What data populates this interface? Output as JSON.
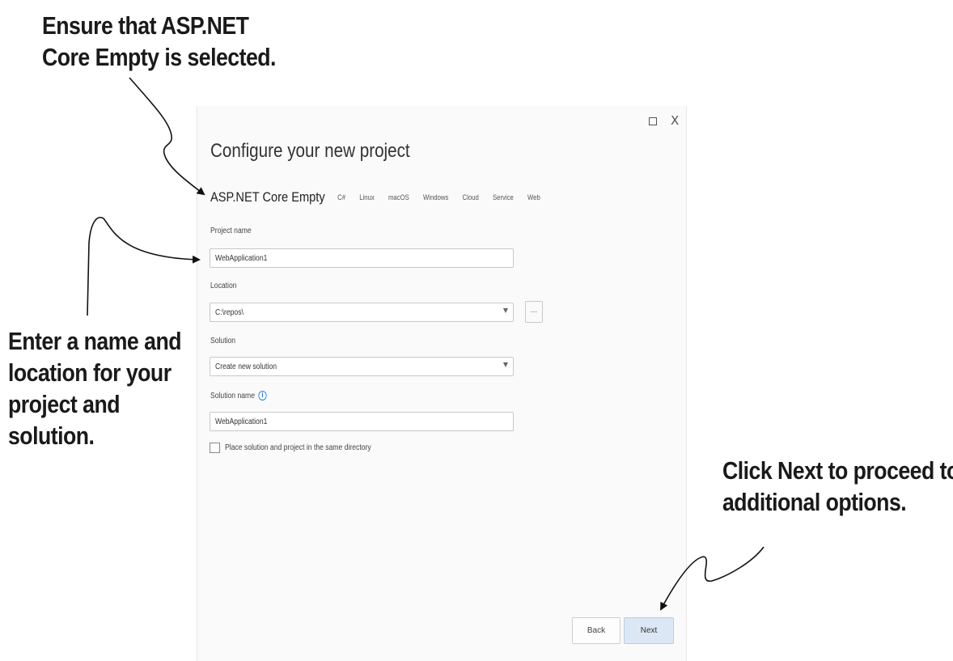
{
  "callouts": {
    "top": [
      "Ensure that ASP.NET",
      "Core Empty is selected."
    ],
    "left": [
      "Enter a name and",
      "location for your",
      "project and",
      "solution."
    ],
    "right": [
      "Click Next to proceed to",
      "additional options."
    ]
  },
  "window": {
    "title": "Configure your new project",
    "template_name": "ASP.NET Core Empty",
    "tags": [
      "C#",
      "Linux",
      "macOS",
      "Windows",
      "Cloud",
      "Service",
      "Web"
    ],
    "maximize_icon": "□",
    "close_icon": "X"
  },
  "form": {
    "project_name_label": "Project name",
    "project_name_value": "WebApplication1",
    "location_label": "Location",
    "location_value": "C:\\repos\\",
    "browse_label": "...",
    "solution_label": "Solution",
    "solution_value": "Create new solution",
    "solution_name_label": "Solution name",
    "solution_name_value": "WebApplication1",
    "same_dir_label": "Place solution and project in the same directory",
    "same_dir_checked": false
  },
  "buttons": {
    "back": "Back",
    "next": "Next"
  }
}
